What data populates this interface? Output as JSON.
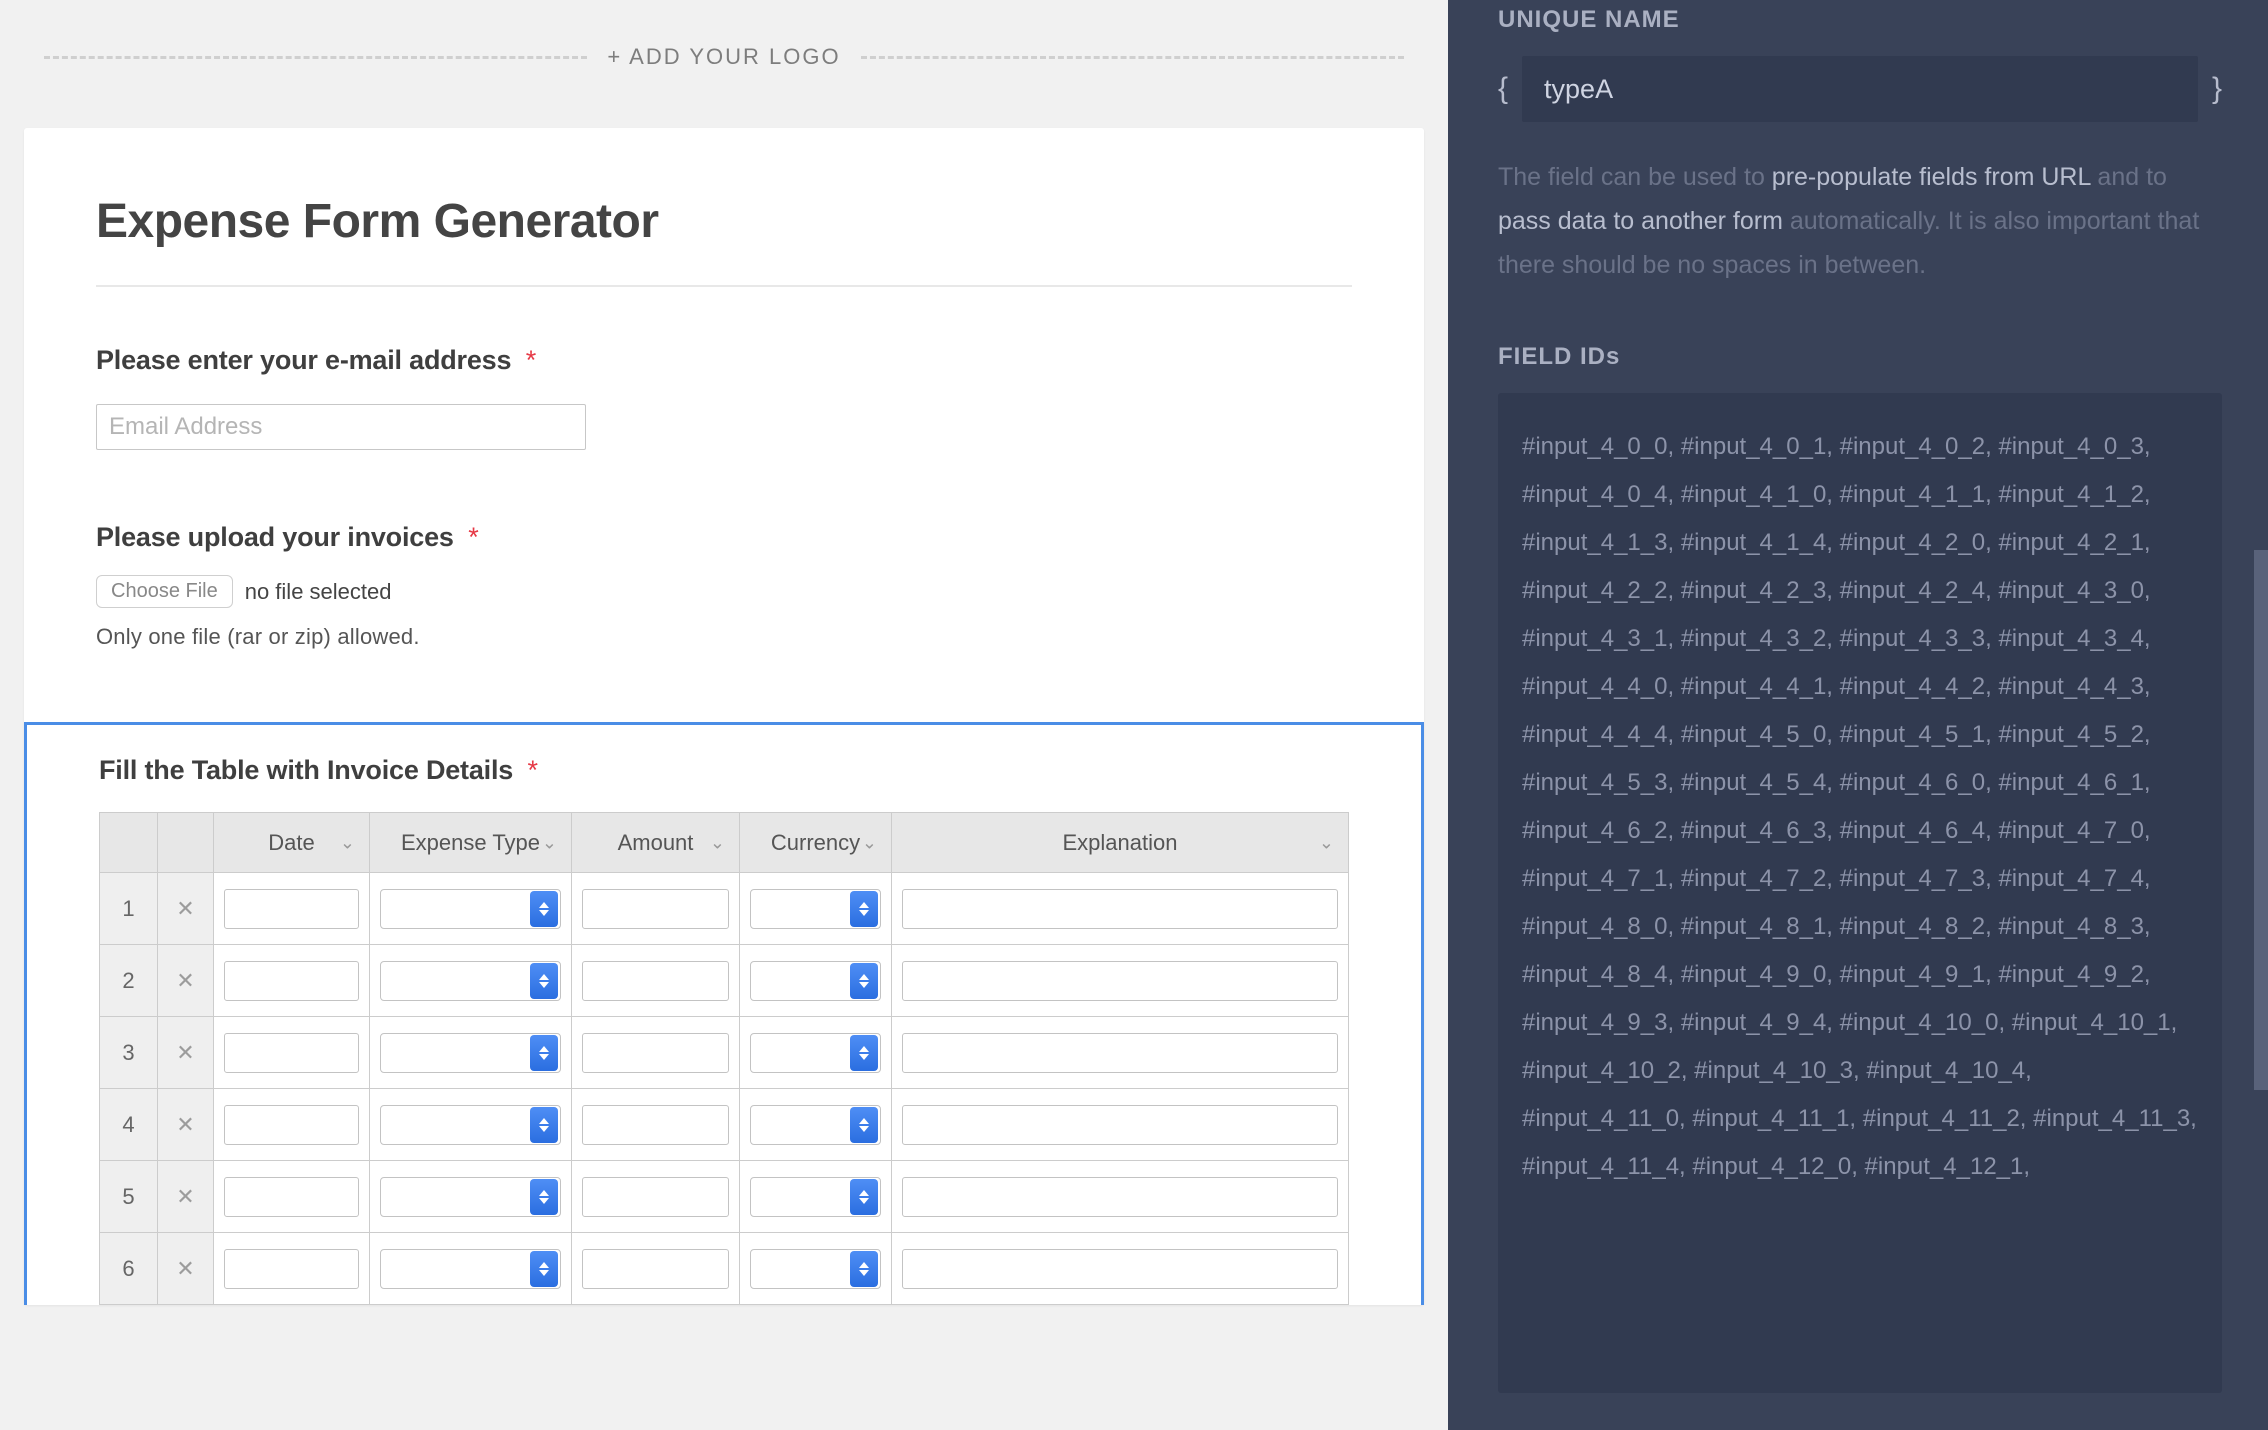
{
  "left": {
    "add_logo": "+ ADD YOUR LOGO",
    "form_title": "Expense Form Generator",
    "email": {
      "label": "Please enter your e-mail address",
      "placeholder": "Email Address"
    },
    "upload": {
      "label": "Please upload your invoices",
      "choose_btn": "Choose File",
      "no_file": "no file selected",
      "hint": "Only one file (rar or zip) allowed."
    },
    "table": {
      "label": "Fill the Table with Invoice Details",
      "headers": {
        "date": "Date",
        "type": "Expense Type",
        "amount": "Amount",
        "currency": "Currency",
        "explanation": "Explanation"
      },
      "rows": [
        1,
        2,
        3,
        4,
        5,
        6
      ]
    }
  },
  "right": {
    "unique_name_label": "UNIQUE NAME",
    "unique_name_value": "typeA",
    "help_pre": "The field can be used to ",
    "help_l1": "pre-populate fields from URL",
    "help_mid": " and to ",
    "help_l2": "pass data to another form",
    "help_post": " automatically. It is also important that there should be no spaces in between.",
    "field_ids_label": "FIELD IDs",
    "field_ids": "#input_4_0_0, #input_4_0_1, #input_4_0_2, #input_4_0_3, #input_4_0_4, #input_4_1_0, #input_4_1_1, #input_4_1_2, #input_4_1_3, #input_4_1_4, #input_4_2_0, #input_4_2_1, #input_4_2_2, #input_4_2_3, #input_4_2_4, #input_4_3_0, #input_4_3_1, #input_4_3_2, #input_4_3_3, #input_4_3_4, #input_4_4_0, #input_4_4_1, #input_4_4_2, #input_4_4_3, #input_4_4_4, #input_4_5_0, #input_4_5_1, #input_4_5_2, #input_4_5_3, #input_4_5_4, #input_4_6_0, #input_4_6_1, #input_4_6_2, #input_4_6_3, #input_4_6_4, #input_4_7_0, #input_4_7_1, #input_4_7_2, #input_4_7_3, #input_4_7_4, #input_4_8_0, #input_4_8_1, #input_4_8_2, #input_4_8_3, #input_4_8_4, #input_4_9_0, #input_4_9_1, #input_4_9_2, #input_4_9_3, #input_4_9_4, #input_4_10_0, #input_4_10_1, #input_4_10_2, #input_4_10_3, #input_4_10_4, #input_4_11_0, #input_4_11_1, #input_4_11_2, #input_4_11_3, #input_4_11_4, #input_4_12_0, #input_4_12_1,"
  }
}
